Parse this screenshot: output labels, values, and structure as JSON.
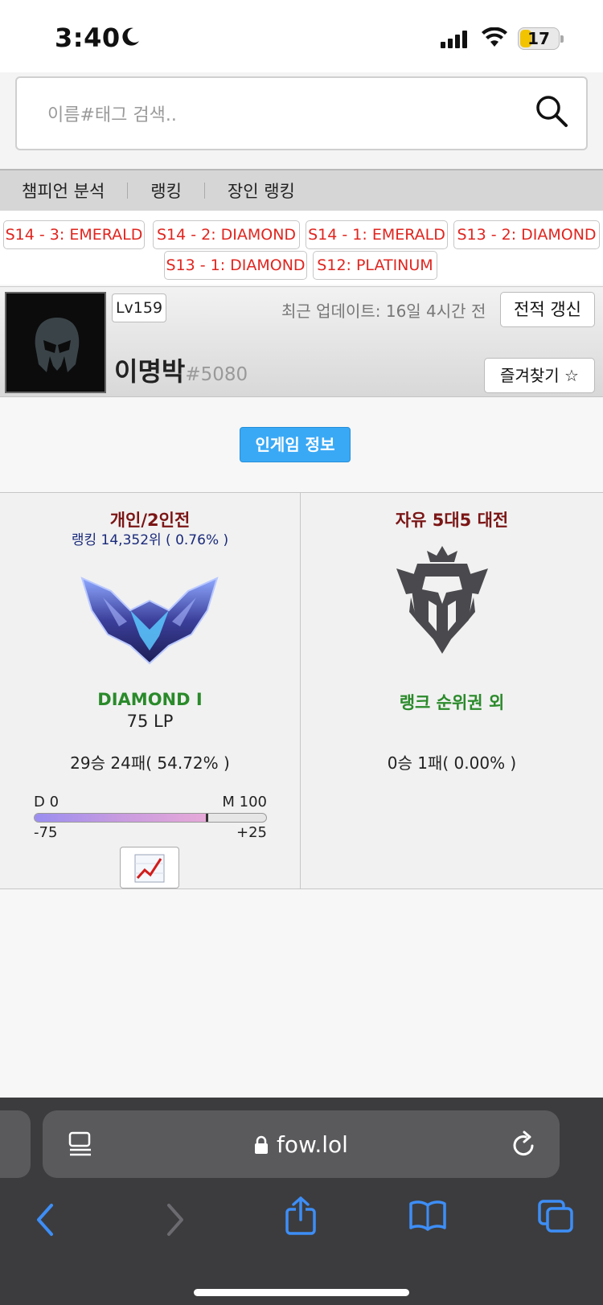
{
  "status": {
    "time": "3:40",
    "battery": "17"
  },
  "search": {
    "placeholder": "이름#태그 검색.."
  },
  "nav": {
    "items": [
      "챔피언 분석",
      "랭킹",
      "장인 랭킹"
    ]
  },
  "seasons": [
    "S14 - 3: EMERALD",
    "S14 - 2: DIAMOND",
    "S14 - 1: EMERALD",
    "S13 - 2: DIAMOND",
    "S13 - 1: DIAMOND",
    "S12: PLATINUM"
  ],
  "profile": {
    "level": "Lv159",
    "updated": "최근 업데이트: 16일 4시간 전",
    "refresh_label": "전적 갱신",
    "name": "이명박",
    "tag": "#5080",
    "favorite_label": "즐겨찾기 ☆"
  },
  "ingame_label": "인게임 정보",
  "solo": {
    "title": "개인/2인전",
    "rank_text": "랭킹 14,352위 ( 0.76% )",
    "tier": "DIAMOND I",
    "lp": "75 LP",
    "record": "29승 24패( 54.72% )",
    "bar_left": "D 0",
    "bar_right": "M 100",
    "bar_sub_left": "-75",
    "bar_sub_right": "+25",
    "progress": 0.75
  },
  "flex": {
    "title": "자유 5대5 대전",
    "tier": "랭크 순위권 외",
    "record": "0승 1패( 0.00% )"
  },
  "browser": {
    "url": "fow.lol"
  },
  "colors": {
    "season_chip": "#e0251f",
    "ingame_button": "#3aa9f5",
    "queue_title": "#7b1515",
    "tier_text": "#2a8a2a"
  }
}
